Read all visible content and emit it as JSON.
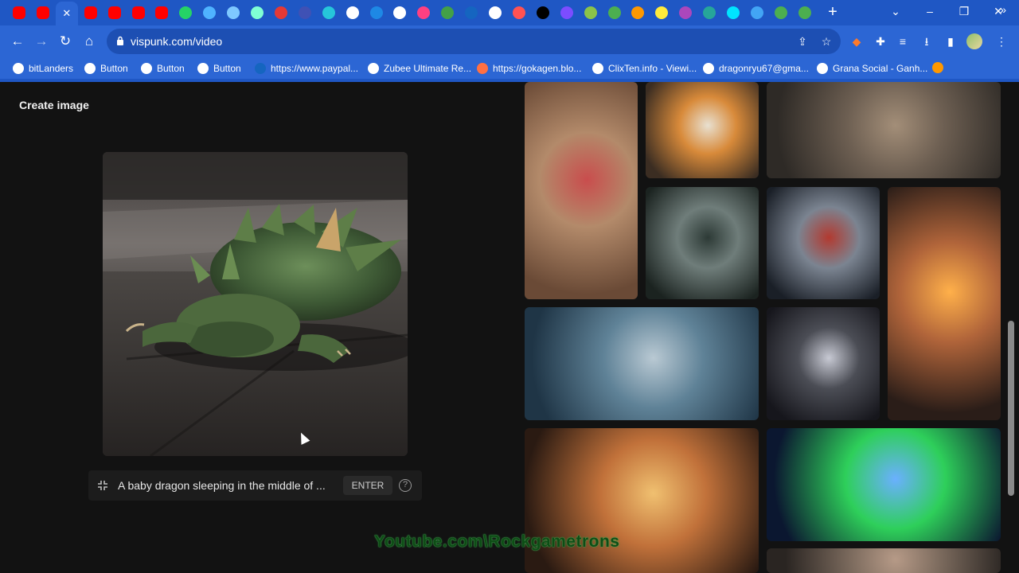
{
  "browser": {
    "tabs": [
      {
        "icon": "youtube-icon",
        "color": "#ff0000"
      },
      {
        "icon": "youtube-icon",
        "color": "#ff0000"
      },
      {
        "icon": "close-icon",
        "color": "#ffffff",
        "active": true
      },
      {
        "icon": "youtube-icon",
        "color": "#ff0000"
      },
      {
        "icon": "youtube-icon",
        "color": "#ff0000"
      },
      {
        "icon": "youtube-icon",
        "color": "#ff0000"
      },
      {
        "icon": "youtube-icon",
        "color": "#ff0000"
      },
      {
        "icon": "whatsapp-icon",
        "color": "#25d366"
      },
      {
        "icon": "site-icon",
        "color": "#4fb3ff"
      },
      {
        "icon": "globe-icon",
        "color": "#7ec8ff"
      },
      {
        "icon": "site-icon",
        "color": "#7fffd4"
      },
      {
        "icon": "site-icon",
        "color": "#e53935"
      },
      {
        "icon": "site-icon",
        "color": "#3f51b5"
      },
      {
        "icon": "site-icon",
        "color": "#26c6da"
      },
      {
        "icon": "site-icon",
        "color": "#ffffff"
      },
      {
        "icon": "site-icon",
        "color": "#1e88e5"
      },
      {
        "icon": "site-icon",
        "color": "#ffffff"
      },
      {
        "icon": "site-icon",
        "color": "#ff4081"
      },
      {
        "icon": "site-icon",
        "color": "#43a047"
      },
      {
        "icon": "site-icon",
        "color": "#1565c0"
      },
      {
        "icon": "site-icon",
        "color": "#ffffff"
      },
      {
        "icon": "site-icon",
        "color": "#ff5252"
      },
      {
        "icon": "site-icon",
        "color": "#000000"
      },
      {
        "icon": "site-icon",
        "color": "#7c4dff"
      },
      {
        "icon": "site-icon",
        "color": "#8bc34a"
      },
      {
        "icon": "play-icon",
        "color": "#4caf50"
      },
      {
        "icon": "bitcoin-icon",
        "color": "#ff9800"
      },
      {
        "icon": "site-icon",
        "color": "#ffeb3b"
      },
      {
        "icon": "star-icon",
        "color": "#ab47bc"
      },
      {
        "icon": "site-icon",
        "color": "#26a69a"
      },
      {
        "icon": "play-icon",
        "color": "#00e5ff"
      },
      {
        "icon": "translate-icon",
        "color": "#42a5f5"
      },
      {
        "icon": "puzzle-icon",
        "color": "#4caf50"
      },
      {
        "icon": "puzzle-icon",
        "color": "#4caf50"
      }
    ],
    "url": "vispunk.com/video",
    "bookmarks": [
      {
        "label": "bitLanders",
        "color": "#ffffff"
      },
      {
        "label": "Button",
        "color": "#ffffff"
      },
      {
        "label": "Button",
        "color": "#ffffff"
      },
      {
        "label": "Button",
        "color": "#ffffff"
      },
      {
        "label": "https://www.paypal...",
        "color": "#1565c0"
      },
      {
        "label": "Zubee Ultimate Re...",
        "color": "#ffffff"
      },
      {
        "label": "https://gokagen.blo...",
        "color": "#ff7043"
      },
      {
        "label": "ClixTen.info - Viewi...",
        "color": "#ffffff"
      },
      {
        "label": "dragonryu67@gma...",
        "color": "#ffffff"
      },
      {
        "label": "Grana Social - Ganh...",
        "color": "#ffffff"
      }
    ]
  },
  "page": {
    "title": "Create image",
    "prompt": {
      "text": "A baby dragon sleeping in the middle of ...",
      "enter_label": "ENTER",
      "help_label": "?"
    },
    "watermark": "Youtube.com\\Rockgametrons"
  },
  "gallery": [
    {
      "name": "kimono-woman-street-thumb",
      "colors": [
        "#6a4a36",
        "#b38a6a",
        "#c94d4d"
      ]
    },
    {
      "name": "goldfish-bowl-thumb",
      "colors": [
        "#3b2d22",
        "#d88a3a",
        "#e8e0d0"
      ]
    },
    {
      "name": "desert-road-thumb",
      "colors": [
        "#2e2a26",
        "#6d5f52",
        "#a38e78"
      ]
    },
    {
      "name": "rainy-window-thumb",
      "colors": [
        "#1b2320",
        "#6f7d7a",
        "#2d3a36"
      ]
    },
    {
      "name": "knight-cape-thumb",
      "colors": [
        "#1a1f27",
        "#7b8491",
        "#b23a30"
      ]
    },
    {
      "name": "glowing-arch-thumb",
      "colors": [
        "#2a1d18",
        "#b0643a",
        "#ffb04a"
      ]
    },
    {
      "name": "sea-monster-thumb",
      "colors": [
        "#1f3546",
        "#5f8297",
        "#b9c9d3"
      ]
    },
    {
      "name": "hooded-warrior-thumb",
      "colors": [
        "#16161c",
        "#4b4d55",
        "#c7c9d3"
      ]
    },
    {
      "name": "market-knight-thumb",
      "colors": [
        "#2a1a12",
        "#c1713a",
        "#f0c070"
      ]
    },
    {
      "name": "aurora-thumb",
      "colors": [
        "#0b1730",
        "#2ecf5a",
        "#6ab0ff"
      ]
    },
    {
      "name": "creature-thumb",
      "colors": [
        "#2a2522",
        "#7b6a5d",
        "#b69a87"
      ]
    }
  ]
}
